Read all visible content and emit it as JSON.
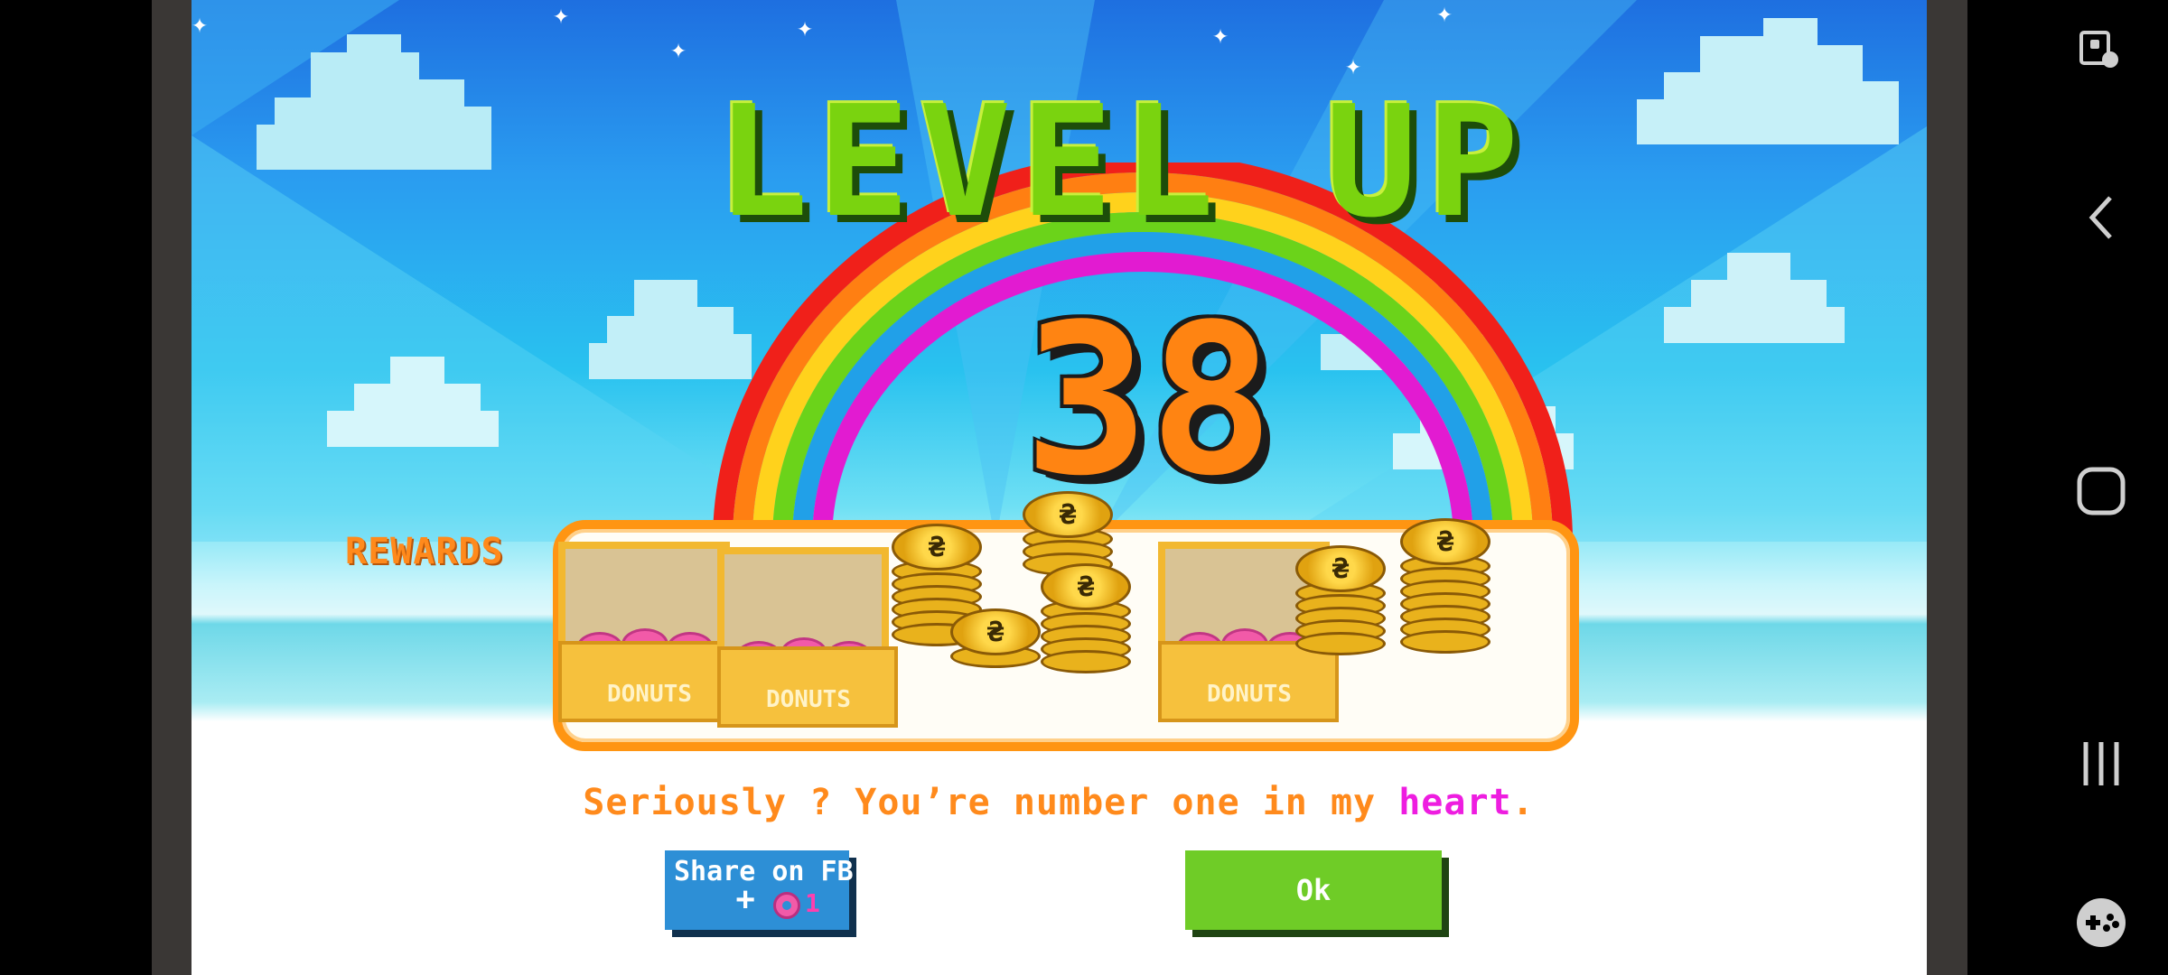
{
  "game": {
    "title": "LEVEL UP",
    "level": "38",
    "rewards_label": "REWARDS",
    "rewards": {
      "donut_box_label": "DONUTS",
      "donut_boxes": 3,
      "coin_stacks": 6
    },
    "message": {
      "main": "Seriously ? You’re number one in my ",
      "highlight": "heart",
      "end": "."
    },
    "share_button": {
      "label": "Share on FB",
      "reward_icon": "donut-icon",
      "reward_count": "1"
    },
    "ok_button": {
      "label": "Ok"
    }
  },
  "nav_bar": {
    "items": [
      {
        "icon": "screen-touch-lock-icon"
      },
      {
        "icon": "back-icon"
      },
      {
        "icon": "home-icon"
      },
      {
        "icon": "recents-icon"
      },
      {
        "icon": "game-controller-icon"
      }
    ]
  },
  "colors": {
    "title_green": "#7ad30f",
    "level_orange": "#ff8412",
    "panel_border": "#ff9512",
    "message_orange": "#ff8a1c",
    "highlight_magenta": "#ee1de0",
    "share_blue": "#2d8fd6",
    "ok_green": "#6fcc27"
  }
}
